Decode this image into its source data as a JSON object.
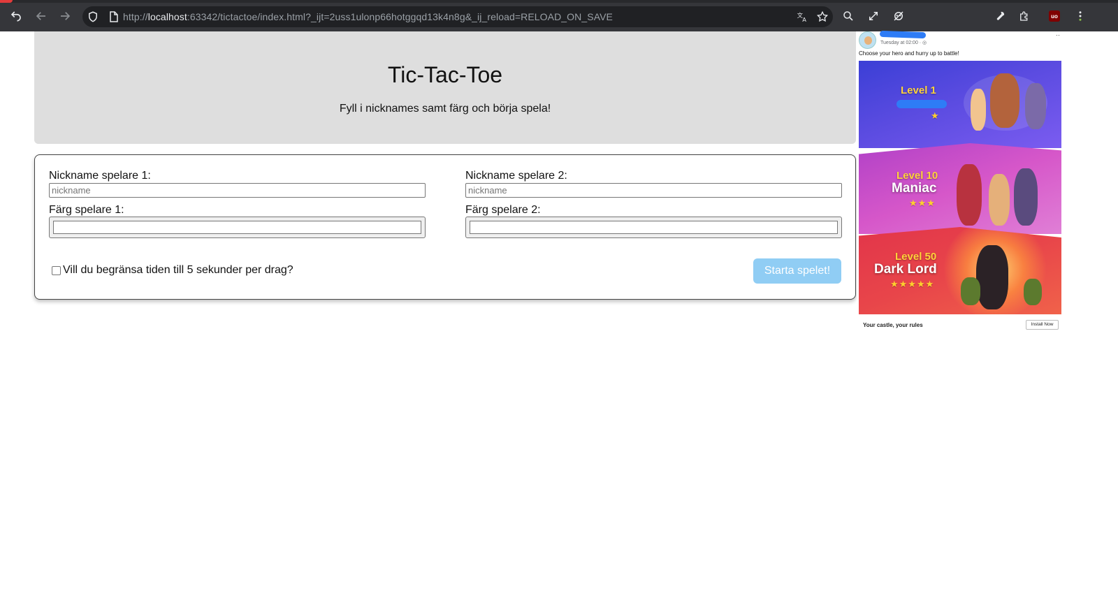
{
  "browser": {
    "url_scheme": "http://",
    "url_host": "localhost",
    "url_rest": ":63342/tictactoe/index.html?_ijt=2uss1ulonp66hotggqd13k4n8g&_ij_reload=RELOAD_ON_SAVE",
    "extension_badge": "uo"
  },
  "header": {
    "title": "Tic-Tac-Toe",
    "subtitle": "Fyll i nicknames samt färg och börja spela!"
  },
  "form": {
    "player1_nick_label": "Nickname spelare 1:",
    "player1_nick_placeholder": "nickname",
    "player1_color_label": "Färg spelare 1:",
    "player2_nick_label": "Nickname spelare 2:",
    "player2_nick_placeholder": "nickname",
    "player2_color_label": "Färg spelare 2:",
    "timer_label": "Vill du begränsa tiden till 5 sekunder per drag?",
    "start_label": "Starta spelet!"
  },
  "ad": {
    "post_time": "Tuesday at 02:00 · ◎",
    "caption": "Choose your hero and hurry up to battle!",
    "level1_label": "Level 1",
    "level1_stars": "★",
    "level10_label": "Level 10",
    "level10_name": "Maniac",
    "level10_stars": "★★★",
    "level50_label": "Level 50",
    "level50_name": "Dark Lord",
    "level50_stars": "★★★★★",
    "footer_text": "Your castle, your rules",
    "install_label": "Install Now",
    "dots": "··"
  }
}
